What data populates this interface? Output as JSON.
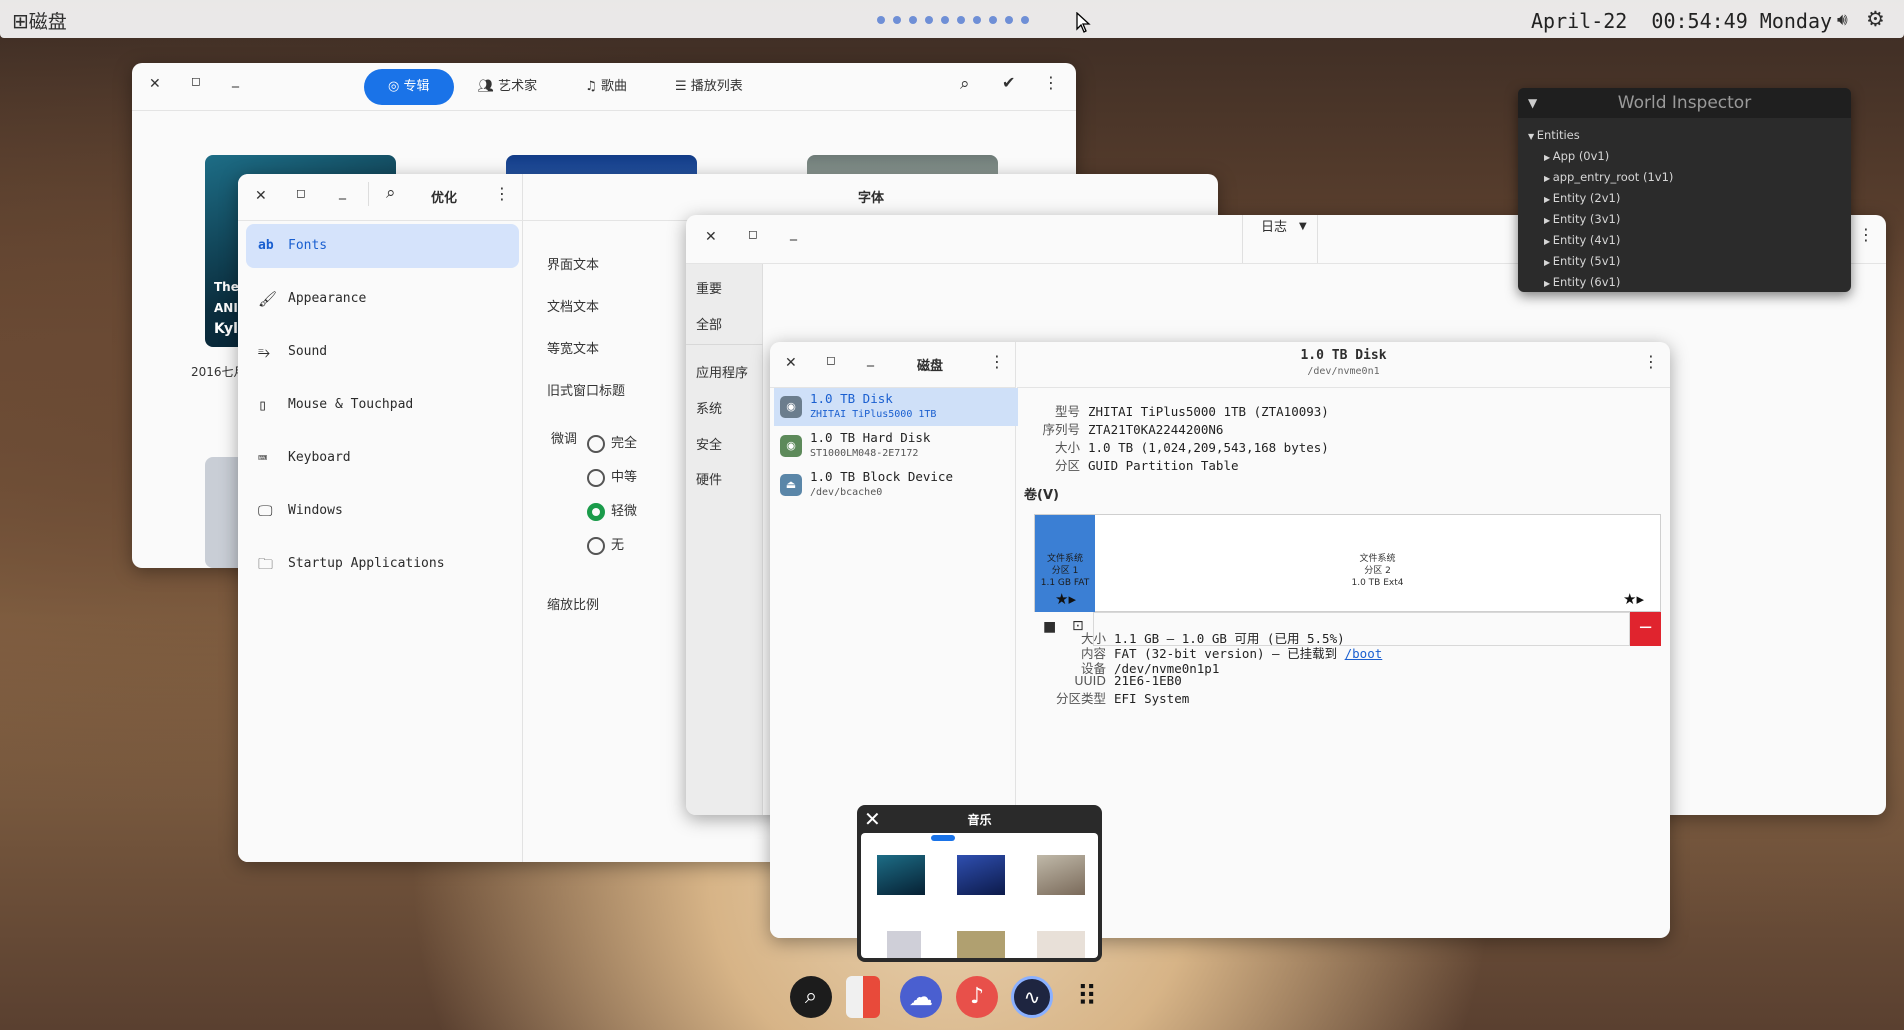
{
  "topbar": {
    "app_name": "磁盘",
    "date": "April-22",
    "time": "00:54:49",
    "weekday": "Monday"
  },
  "music": {
    "tabs": [
      "专辑",
      "艺术家",
      "歌曲",
      "播放列表"
    ],
    "album_year_partial": "2016七月",
    "cover_text_partial": [
      "The",
      "ANI",
      "Kyl"
    ]
  },
  "tweaks": {
    "title": "优化",
    "panel_title": "字体",
    "sidebar": [
      "Fonts",
      "Appearance",
      "Sound",
      "Mouse & Touchpad",
      "Keyboard",
      "Windows",
      "Startup Applications"
    ],
    "labels": [
      "界面文本",
      "文档文本",
      "等宽文本",
      "旧式窗口标题"
    ],
    "hinting_label": "微调",
    "hinting_options": [
      "完全",
      "中等",
      "轻微",
      "无"
    ],
    "hinting_selected": "轻微",
    "scale_label": "缩放比例"
  },
  "logs": {
    "dropdown": "日志",
    "categories": [
      "重要",
      "全部",
      "应用程序",
      "系统",
      "安全",
      "硬件"
    ]
  },
  "disks": {
    "title": "磁盘",
    "devices": [
      {
        "name": "1.0 TB Disk",
        "sub": "ZHITAI TiPlus5000 1TB"
      },
      {
        "name": "1.0 TB Hard Disk",
        "sub": "ST1000LM048-2E7172"
      },
      {
        "name": "1.0 TB Block Device",
        "sub": "/dev/bcache0"
      }
    ],
    "header_title": "1.0 TB Disk",
    "header_sub": "/dev/nvme0n1",
    "info": [
      {
        "k": "型号",
        "v": "ZHITAI TiPlus5000 1TB (ZTA10093)"
      },
      {
        "k": "序列号",
        "v": "ZTA21T0KA2244200N6"
      },
      {
        "k": "大小",
        "v": "1.0 TB (1,024,209,543,168 bytes)"
      },
      {
        "k": "分区",
        "v": "GUID Partition Table"
      }
    ],
    "volumes_label": "卷(V)",
    "part1": [
      "文件系统",
      "分区 1",
      "1.1 GB FAT"
    ],
    "part2": [
      "文件系统",
      "分区 2",
      "1.0 TB Ext4"
    ],
    "details": [
      {
        "k": "大小",
        "v": "1.1 GB — 1.0 GB 可用 (已用 5.5%)"
      },
      {
        "k": "内容",
        "v": "FAT (32-bit version) — 已挂载到 ",
        "link": "/boot"
      },
      {
        "k": "设备",
        "v": "/dev/nvme0n1p1"
      },
      {
        "k": "UUID",
        "v": "21E6-1EB0"
      },
      {
        "k": "分区类型",
        "v": "EFI System"
      }
    ]
  },
  "inspector": {
    "title": "World Inspector",
    "root": "Entities",
    "items": [
      "App (0v1)",
      "app_entry_root (1v1)",
      "Entity (2v1)",
      "Entity (3v1)",
      "Entity (4v1)",
      "Entity (5v1)",
      "Entity (6v1)"
    ]
  },
  "music_thumb": {
    "title": "音乐"
  },
  "colors": {
    "accent": "#1a73e8",
    "selection": "#d5e3fb",
    "radio_on": "#1a9b4a",
    "partition_fat": "#3b7fd4",
    "danger": "#e0242e"
  }
}
